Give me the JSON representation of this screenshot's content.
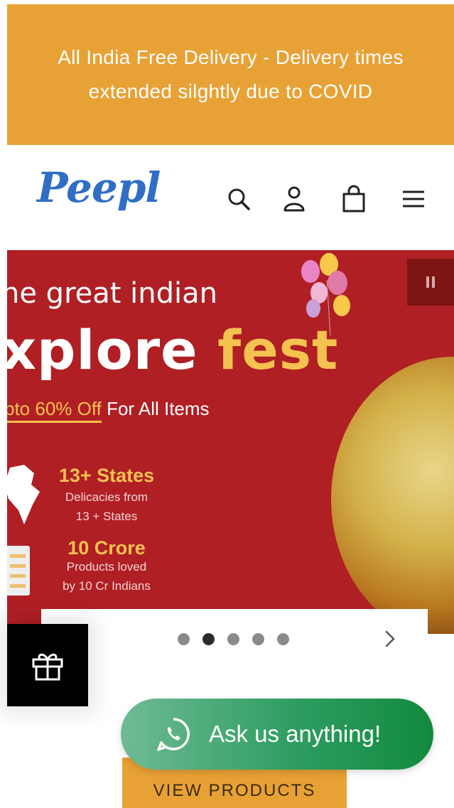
{
  "announcement": {
    "text": "All India Free Delivery - Delivery times extended silghtly due to COVID"
  },
  "header": {
    "logo": "Peepl",
    "icons": [
      "search-icon",
      "account-icon",
      "cart-icon",
      "menu-icon"
    ]
  },
  "banner": {
    "line1": "he great indian",
    "line2_a": "xplore ",
    "line2_b": "fest",
    "line3_highlight": "pto 60% Off",
    "line3_rest": " For All Items",
    "stat1_title": "13+ States",
    "stat1_sub1": "Delicacies from",
    "stat1_sub2": "13 + States",
    "stat2_title": "10 Crore",
    "stat2_sub1": "Products loved",
    "stat2_sub2": "by 10 Cr Indians",
    "colors": {
      "background": "#b01f24",
      "accent": "#f4c24f"
    }
  },
  "slider": {
    "dot_count": 5,
    "active_index": 1
  },
  "whatsapp": {
    "label": "Ask us anything!"
  },
  "cta": {
    "view_products": "VIEW PRODUCTS"
  },
  "colors": {
    "brand_orange": "#e8a135",
    "logo_blue": "#2f6ec5",
    "whatsapp_green": "#128a3e"
  }
}
